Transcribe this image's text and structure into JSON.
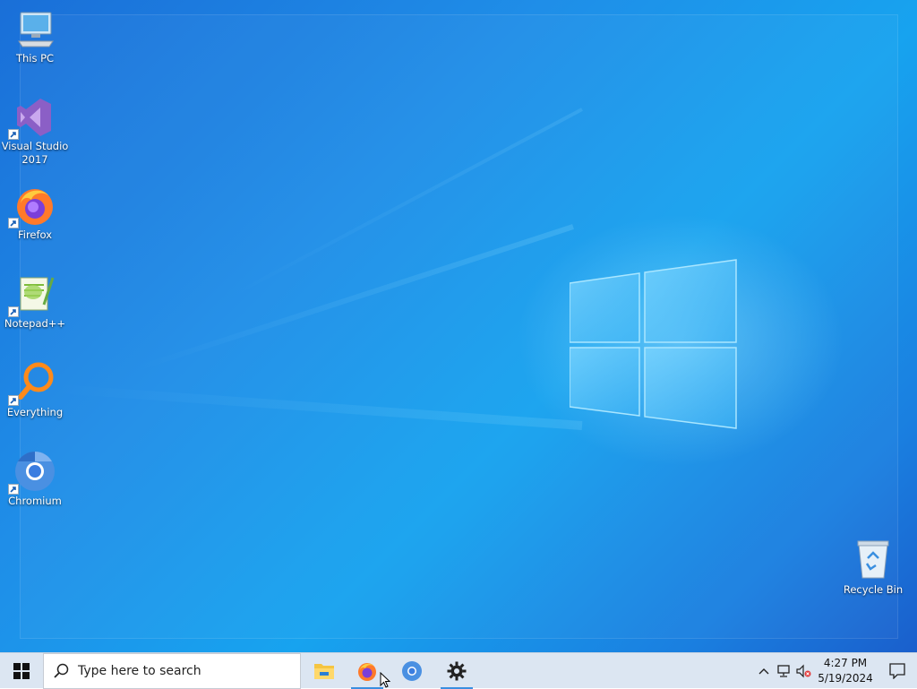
{
  "desktop": {
    "icons": [
      {
        "label": "This PC"
      },
      {
        "label": "Visual Studio 2017"
      },
      {
        "label": "Firefox"
      },
      {
        "label": "Notepad++"
      },
      {
        "label": "Everything"
      },
      {
        "label": "Chromium"
      },
      {
        "label": "Recycle Bin"
      }
    ]
  },
  "taskbar": {
    "search_placeholder": "Type here to search",
    "apps": [
      {
        "name": "file-explorer-icon",
        "active": false
      },
      {
        "name": "firefox-icon",
        "active": true
      },
      {
        "name": "chromium-icon",
        "active": false
      },
      {
        "name": "settings-icon",
        "active": true
      }
    ],
    "clock": {
      "time": "4:27 PM",
      "date": "5/19/2024"
    }
  },
  "colors": {
    "wallpaper_accent": "#1a8fe8",
    "taskbar_bg": "#dce6f2",
    "active_indicator": "#3a8fe0"
  }
}
